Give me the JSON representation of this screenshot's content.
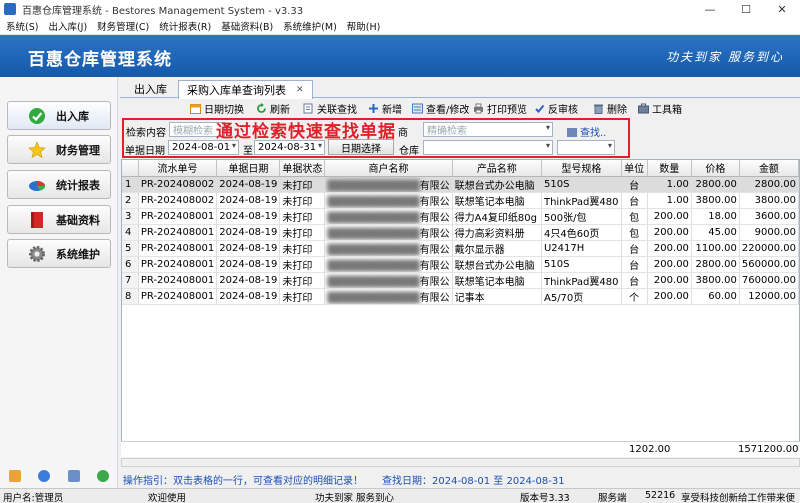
{
  "window": {
    "title": "百惠仓库管理系统 - Bestores Management System - v3.33",
    "controls": [
      "—",
      "☐",
      "✕"
    ]
  },
  "menu": [
    "系统(S)",
    "出入库(J)",
    "财务管理(C)",
    "统计报表(R)",
    "基础资料(B)",
    "系统维护(M)",
    "帮助(H)"
  ],
  "banner": {
    "brand": "百惠仓库管理系统",
    "slogan": "功夫到家 服务到心"
  },
  "sidebar": {
    "items": [
      {
        "label": "出入库",
        "icon": "check-icon"
      },
      {
        "label": "财务管理",
        "icon": "star-icon"
      },
      {
        "label": "统计报表",
        "icon": "pie-chart-icon"
      },
      {
        "label": "基础资料",
        "icon": "book-icon"
      },
      {
        "label": "系统维护",
        "icon": "gear-icon"
      }
    ]
  },
  "tabs": [
    {
      "label": "出入库"
    },
    {
      "label": "采购入库单查询列表",
      "close": "✕"
    }
  ],
  "toolbar": [
    {
      "label": "日期切换",
      "icon": "calendar-icon"
    },
    {
      "label": "刷新",
      "icon": "refresh-icon"
    },
    {
      "label": "关联查找",
      "icon": "link-search-icon"
    },
    {
      "label": "新增",
      "icon": "add-icon"
    },
    {
      "label": "查看/修改",
      "icon": "view-edit-icon"
    },
    {
      "label": "打印预览",
      "icon": "print-icon"
    },
    {
      "label": "反审核",
      "icon": "unaudit-icon"
    },
    {
      "label": "删除",
      "icon": "delete-icon"
    },
    {
      "label": "工具箱",
      "icon": "toolbox-icon"
    }
  ],
  "filter": {
    "search_label": "检索内容",
    "search_placeholder": "模糊检索",
    "precise_label": "商",
    "precise_placeholder": "精确检索",
    "find_button": "查找..",
    "date_label": "单据日期",
    "date_from": "2024-08-01",
    "date_to_label": "至",
    "date_to": "2024-08-31",
    "date_pick_button": "日期选择",
    "warehouse_label": "仓库",
    "warehouse_value": "",
    "extra_value": ""
  },
  "overlay_title": "通过检索快速查找单据",
  "grid": {
    "columns": [
      "",
      "流水单号",
      "单据日期",
      "单据状态",
      "商户名称",
      "产品名称",
      "型号规格",
      "单位",
      "数量",
      "价格",
      "金额"
    ],
    "rows": [
      [
        "1",
        "PR-202408002",
        "2024-08-19",
        "未打印",
        "████████████有限公",
        "联想台式办公电脑",
        "510S",
        "台",
        "1.00",
        "2800.00",
        "2800.00"
      ],
      [
        "2",
        "PR-202408002",
        "2024-08-19",
        "未打印",
        "████████████有限公",
        "联想笔记本电脑",
        "ThinkPad翼480",
        "台",
        "1.00",
        "3800.00",
        "3800.00"
      ],
      [
        "3",
        "PR-202408001",
        "2024-08-19",
        "未打印",
        "████████████有限公",
        "得力A4复印纸80g",
        "500张/包",
        "包",
        "200.00",
        "18.00",
        "3600.00"
      ],
      [
        "4",
        "PR-202408001",
        "2024-08-19",
        "未打印",
        "████████████有限公",
        "得力高彩资料册",
        "4只4色60页",
        "包",
        "200.00",
        "45.00",
        "9000.00"
      ],
      [
        "5",
        "PR-202408001",
        "2024-08-19",
        "未打印",
        "████████████有限公",
        "戴尔显示器",
        "U2417H",
        "台",
        "200.00",
        "1100.00",
        "220000.00"
      ],
      [
        "6",
        "PR-202408001",
        "2024-08-19",
        "未打印",
        "████████████有限公",
        "联想台式办公电脑",
        "510S",
        "台",
        "200.00",
        "2800.00",
        "560000.00"
      ],
      [
        "7",
        "PR-202408001",
        "2024-08-19",
        "未打印",
        "████████████有限公",
        "联想笔记本电脑",
        "ThinkPad翼480",
        "台",
        "200.00",
        "3800.00",
        "760000.00"
      ],
      [
        "8",
        "PR-202408001",
        "2024-08-19",
        "未打印",
        "████████████有限公",
        "记事本",
        "A5/70页",
        "个",
        "200.00",
        "60.00",
        "12000.00"
      ]
    ],
    "total_qty": "1202.00",
    "total_amount": "1571200.00"
  },
  "hint": {
    "tip": "操作指引：双击表格的一行，可查看对应的明细记录！",
    "range_label": "查找日期：",
    "range_value": "2024-08-01 至 2024-08-31"
  },
  "status": {
    "user": "用户名:管理员",
    "welcome": "欢迎使用",
    "slogan": "功夫到家 服务到心",
    "version": "版本号3.33",
    "server": "服务端",
    "port": "52216",
    "company": "享受科技创新给工作带来便"
  },
  "colors": {
    "banner": "#1f66b8",
    "highlight": "#e0202a",
    "hint": "#1a4fb0"
  }
}
